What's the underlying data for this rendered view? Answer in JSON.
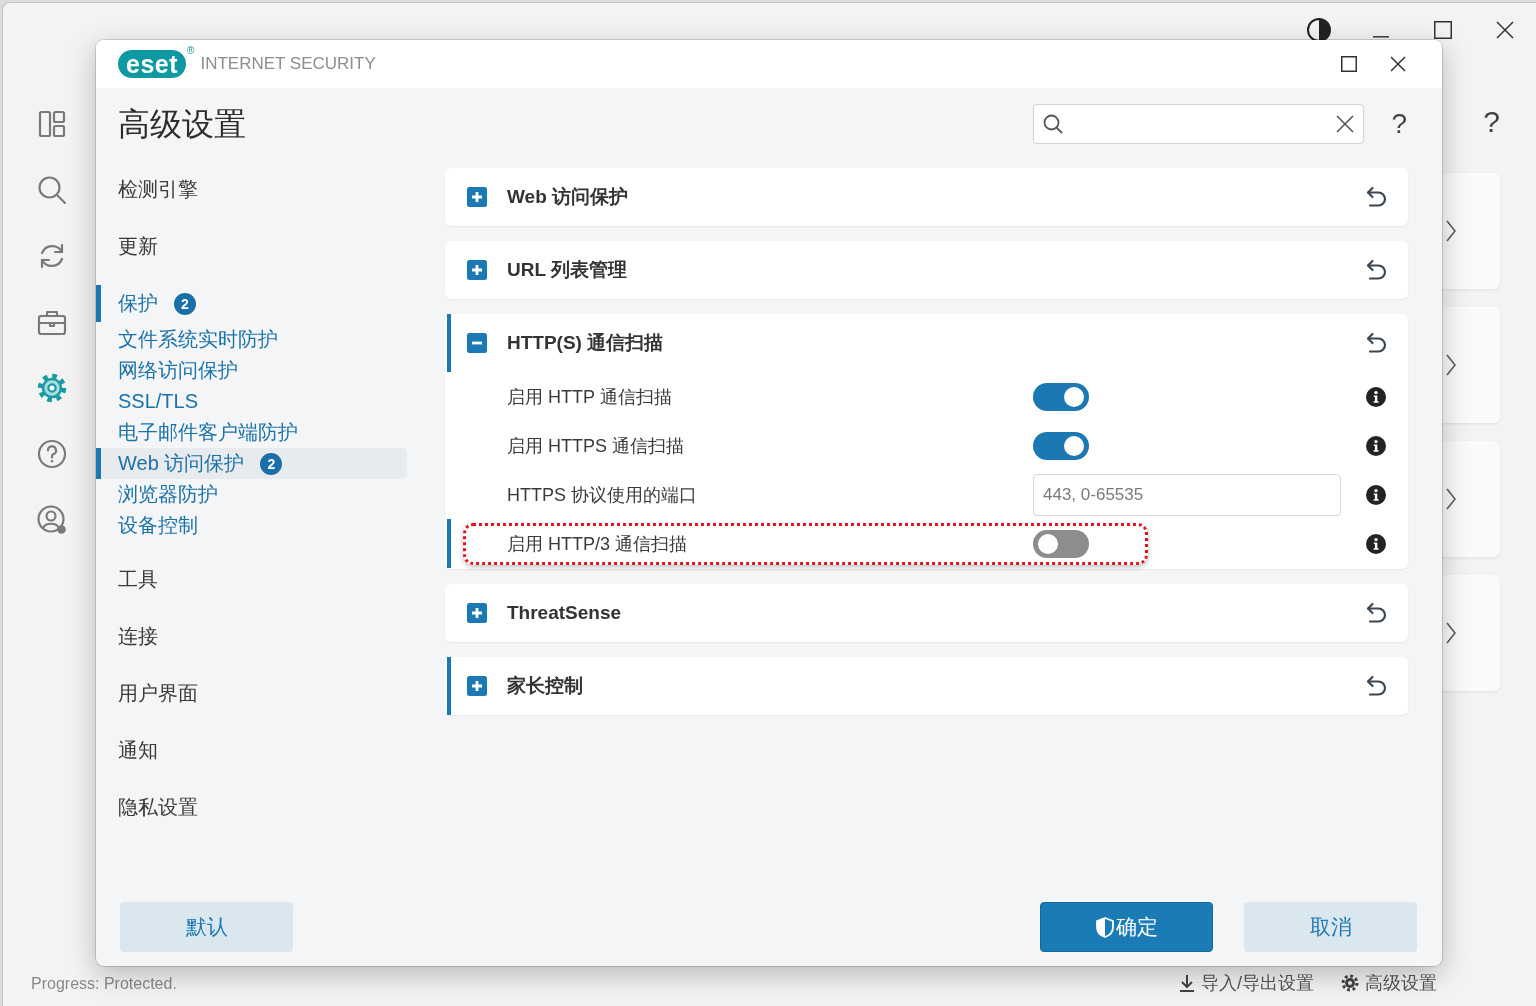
{
  "background_window": {
    "window_controls": [
      {
        "kind": "contrast"
      },
      {
        "kind": "minimize"
      },
      {
        "kind": "maximize"
      },
      {
        "kind": "close"
      }
    ],
    "nav_icons": [
      {
        "kind": "dashboard",
        "selected": false
      },
      {
        "kind": "search",
        "selected": false
      },
      {
        "kind": "refresh",
        "selected": false
      },
      {
        "kind": "tools",
        "selected": false
      },
      {
        "kind": "settings",
        "selected": true
      },
      {
        "kind": "help",
        "selected": false
      },
      {
        "kind": "account",
        "selected": false
      }
    ],
    "help_label": "?",
    "status_bar": {
      "text": "Progress: Protected.",
      "links": [
        {
          "kind": "import_export",
          "label": "导入/导出设置"
        },
        {
          "kind": "advanced",
          "label": "高级设置"
        }
      ]
    }
  },
  "dialog": {
    "logo": {
      "text": "eset",
      "mark": "®"
    },
    "product": "INTERNET SECURITY",
    "window_controls": [
      {
        "kind": "maximize"
      },
      {
        "kind": "close"
      }
    ],
    "title": "高级设置",
    "help_label": "?",
    "nav": [
      {
        "label": "检测引擎",
        "selected": false,
        "expanded": false,
        "changed": false
      },
      {
        "label": "更新",
        "selected": false,
        "expanded": false,
        "changed": false
      },
      {
        "label": "保护",
        "selected": false,
        "expanded": true,
        "changed": true,
        "badge": "2",
        "children": [
          {
            "label": "文件系统实时防护",
            "selected": false,
            "changed": false
          },
          {
            "label": "网络访问保护",
            "selected": false,
            "changed": false
          },
          {
            "label": "SSL/TLS",
            "selected": false,
            "changed": false
          },
          {
            "label": "电子邮件客户端防护",
            "selected": false,
            "changed": false
          },
          {
            "label": "Web 访问保护",
            "selected": true,
            "changed": true,
            "badge": "2"
          },
          {
            "label": "浏览器防护",
            "selected": false,
            "changed": false
          },
          {
            "label": "设备控制",
            "selected": false,
            "changed": false
          }
        ]
      },
      {
        "label": "工具",
        "selected": false,
        "expanded": false,
        "changed": false
      },
      {
        "label": "连接",
        "selected": false,
        "expanded": false,
        "changed": false
      },
      {
        "label": "用户界面",
        "selected": false,
        "expanded": false,
        "changed": false
      },
      {
        "label": "通知",
        "selected": false,
        "expanded": false,
        "changed": false
      },
      {
        "label": "隐私设置",
        "selected": false,
        "expanded": false,
        "changed": false
      }
    ],
    "sections": [
      {
        "title": "Web 访问保护",
        "expanded": false,
        "changed": false
      },
      {
        "title": "URL 列表管理",
        "expanded": false,
        "changed": false
      },
      {
        "title": "HTTP(S) 通信扫描",
        "expanded": true,
        "changed": true,
        "rows": [
          {
            "kind": "toggle",
            "label": "启用 HTTP 通信扫描",
            "on": true,
            "changed": false,
            "highlighted": false
          },
          {
            "kind": "toggle",
            "label": "启用 HTTPS 通信扫描",
            "on": true,
            "changed": false,
            "highlighted": false
          },
          {
            "kind": "text",
            "label": "HTTPS 协议使用的端口",
            "value": "443, 0-65535",
            "changed": false,
            "highlighted": false
          },
          {
            "kind": "toggle",
            "label": "启用 HTTP/3 通信扫描",
            "on": false,
            "changed": true,
            "highlighted": true
          }
        ]
      },
      {
        "title": "ThreatSense",
        "expanded": false,
        "changed": false
      },
      {
        "title": "家长控制",
        "expanded": false,
        "changed": true
      }
    ],
    "buttons": [
      {
        "kind": "default",
        "label": "默认"
      },
      {
        "kind": "primary",
        "label": "确定"
      },
      {
        "kind": "cancel",
        "label": "取消"
      }
    ]
  }
}
